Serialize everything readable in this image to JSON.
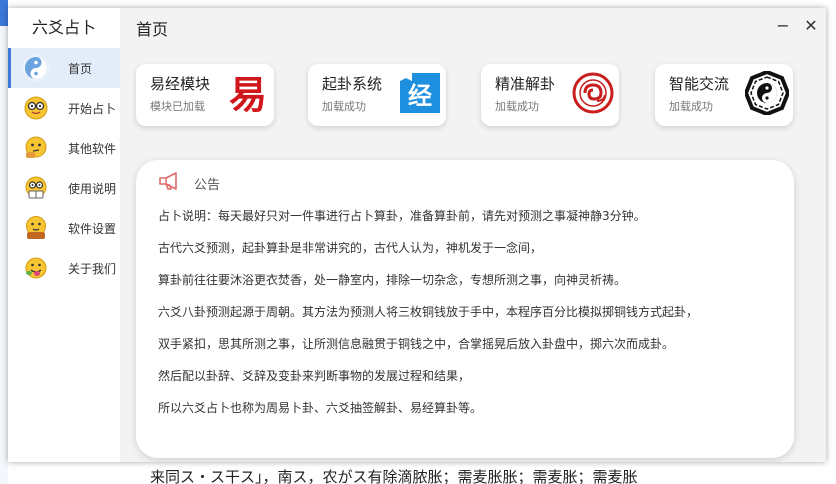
{
  "app": {
    "title": "六爻占卜",
    "page_title": "首页"
  },
  "window_controls": {
    "minimize": "−",
    "close": "✕"
  },
  "sidebar": {
    "items": [
      {
        "label": "首页",
        "icon": "yin-yang-icon",
        "active": true
      },
      {
        "label": "开始占卜",
        "icon": "glasses-emoji-icon",
        "active": false
      },
      {
        "label": "其他软件",
        "icon": "thinking-emoji-icon",
        "active": false
      },
      {
        "label": "使用说明",
        "icon": "reading-emoji-icon",
        "active": false
      },
      {
        "label": "软件设置",
        "icon": "settings-emoji-icon",
        "active": false
      },
      {
        "label": "关于我们",
        "icon": "tongue-emoji-icon",
        "active": false
      }
    ]
  },
  "cards": [
    {
      "title": "易经模块",
      "subtitle": "模块已加载",
      "icon": "yi-character-icon",
      "glyph": "易"
    },
    {
      "title": "起卦系统",
      "subtitle": "加载成功",
      "icon": "jing-book-icon",
      "glyph": "经"
    },
    {
      "title": "精准解卦",
      "subtitle": "加载成功",
      "icon": "swirl-circle-icon"
    },
    {
      "title": "智能交流",
      "subtitle": "加载成功",
      "icon": "bagua-icon"
    }
  ],
  "notice": {
    "title": "公告",
    "icon": "megaphone-icon",
    "lines": [
      "占卜说明：每天最好只对一件事进行占卜算卦，准备算卦前，请先对预测之事凝神静3分钟。",
      "古代六爻预测，起卦算卦是非常讲究的，古代人认为，神机发于一念间，",
      "算卦前往往要沐浴更衣焚香，处一静室内，排除一切杂念，专想所测之事，向神灵祈祷。",
      "六爻八卦预测起源于周朝。其方法为预测人将三枚铜钱放于手中，本程序百分比模拟掷铜钱方式起卦，",
      "双手紧扣，思其所测之事，让所测信息融贯于铜钱之中，合掌摇晃后放入卦盘中，掷六次而成卦。",
      "然后配以卦辞、爻辞及变卦来判断事物的发展过程和结果，",
      "所以六爻占卜也称为周易卜卦、六爻抽签解卦、易经算卦等。"
    ]
  },
  "background": {
    "bottom_text": "来同ス・ス干ス」，南ス，农がス有除滴脓胀；需麦胀胀；需麦胀；需麦胀"
  },
  "colors": {
    "accent": "#3c78d8",
    "active_nav_bg": "#e3ecf9",
    "content_bg": "#f3f3f3",
    "yi_red": "#d0171b",
    "book_blue": "#1f8fe0"
  }
}
